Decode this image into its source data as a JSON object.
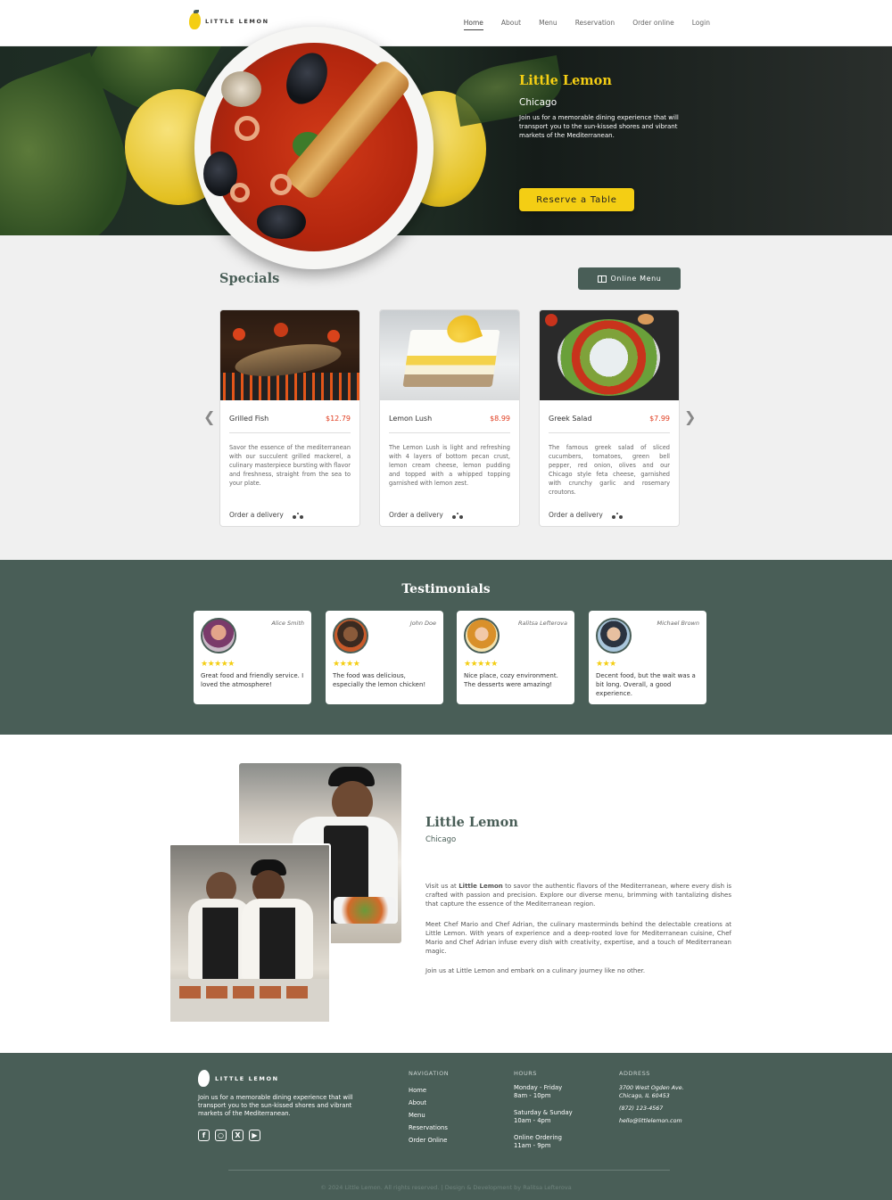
{
  "header": {
    "brand": "LITTLE LEMON",
    "nav": [
      "Home",
      "About",
      "Menu",
      "Reservation",
      "Order online",
      "Login"
    ]
  },
  "hero": {
    "title": "Little Lemon",
    "subtitle": "Chicago",
    "description": "Join us for a memorable dining experience that will transport you to the sun-kissed shores and vibrant markets of the Mediterranean.",
    "button": "Reserve a Table"
  },
  "specials": {
    "title": "Specials",
    "menu_button": "Online Menu",
    "items": [
      {
        "name": "Grilled Fish",
        "price": "$12.79",
        "description": "Savor the essence of the mediterranean with our succulent grilled mackerel, a culinary masterpiece bursting with flavor and freshness, straight from the sea to your plate.",
        "order": "Order a delivery"
      },
      {
        "name": "Lemon Lush",
        "price": "$8.99",
        "description": "The Lemon Lush is light and refreshing with 4 layers of bottom pecan crust, lemon cream cheese, lemon pudding and topped with a whipped topping garnished with lemon zest.",
        "order": "Order a delivery"
      },
      {
        "name": "Greek Salad",
        "price": "$7.99",
        "description": "The famous greek salad of sliced cucumbers, tomatoes, green bell pepper, red onion, olives and our Chicago style feta cheese, garnished with crunchy garlic and rosemary croutons.",
        "order": "Order a delivery"
      }
    ]
  },
  "testimonials": {
    "title": "Testimonials",
    "items": [
      {
        "name": "Alice Smith",
        "stars": "★★★★★",
        "rating": 5,
        "text": "Great food and friendly service. I loved the atmosphere!"
      },
      {
        "name": "John Doe",
        "stars": "★★★★",
        "rating": 4,
        "text": "The food was delicious, especially the lemon chicken!"
      },
      {
        "name": "Ralitsa Lefterova",
        "stars": "★★★★★",
        "rating": 5,
        "text": "Nice place, cozy environment. The desserts were amazing!"
      },
      {
        "name": "Michael Brown",
        "stars": "★★★",
        "rating": 3,
        "text": "Decent food, but the wait was a bit long. Overall, a good experience."
      }
    ]
  },
  "about": {
    "title": "Little Lemon",
    "subtitle": "Chicago",
    "p1_before": "Visit us at ",
    "p1_bold": "Little Lemon",
    "p1_after": " to savor the authentic flavors of the Mediterranean, where every dish is crafted with passion and precision. Explore our diverse menu, brimming with tantalizing dishes that capture the essence of the Mediterranean region.",
    "p2": "Meet Chef Mario and Chef Adrian, the culinary masterminds behind the delectable creations at Little Lemon. With years of experience and a deep-rooted love for Mediterranean cuisine, Chef Mario and Chef Adrian infuse every dish with creativity, expertise, and a touch of Mediterranean magic.",
    "p3": "Join us at Little Lemon and embark on a culinary journey like no other."
  },
  "footer": {
    "brand": "LITTLE LEMON",
    "description": "Join us for a memorable dining experience that will transport you to the sun-kissed shores and vibrant markets of the Mediterranean.",
    "nav_heading": "NAVIGATION",
    "nav": [
      "Home",
      "About",
      "Menu",
      "Reservations",
      "Order Online"
    ],
    "hours_heading": "HOURS",
    "hours": [
      {
        "days": "Monday - Friday",
        "time": "8am - 10pm"
      },
      {
        "days": "Saturday & Sunday",
        "time": "10am - 4pm"
      },
      {
        "days": "Online Ordering",
        "time": "11am - 9pm"
      }
    ],
    "address_heading": "ADDRESS",
    "address_line1": "3700 West Ogden Ave.",
    "address_line2": "Chicago, IL 60453",
    "phone": "(872) 123-4567",
    "email": "hello@littlelemon.com",
    "copyright": "© 2024 Little Lemon. All rights reserved.   |   Design & Development by Ralitsa Lefterova"
  },
  "colors": {
    "primary": "#495e57",
    "accent": "#f4ce14",
    "price": "#e03c1f",
    "light_bg": "#f0f0f0"
  },
  "icons": [
    "lemon-logo-icon",
    "book-icon",
    "chevron-left-icon",
    "chevron-right-icon",
    "scooter-icon",
    "facebook-icon",
    "instagram-icon",
    "x-icon",
    "youtube-icon"
  ]
}
